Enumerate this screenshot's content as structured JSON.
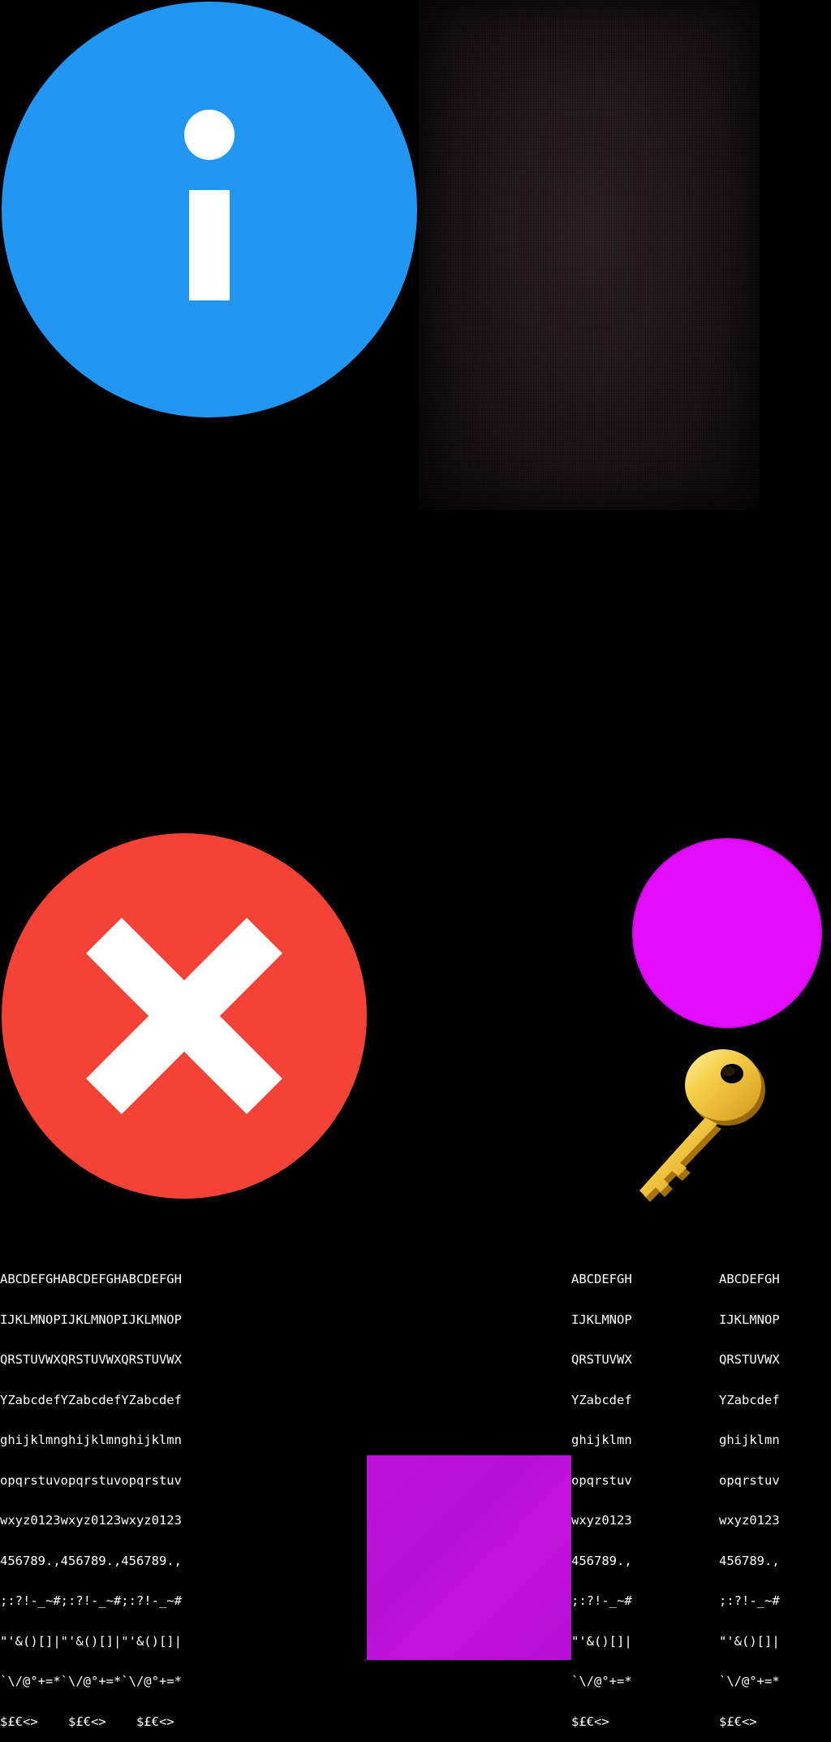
{
  "sprites": {
    "info_icon": {
      "icon": "info-icon",
      "circle_color": "#2196f3",
      "glyph_color": "#ffffff"
    },
    "fabric_texture": {
      "icon": "fabric-texture",
      "base_color": "#1d1517"
    },
    "close_icon": {
      "icon": "close-icon",
      "circle_color": "#f44336",
      "glyph_color": "#ffffff"
    },
    "magenta_circle": {
      "icon": "circle-shape",
      "color": "#e60cff"
    },
    "key_icon": {
      "icon": "key-icon",
      "color": "#f2c33a"
    },
    "purple_square": {
      "icon": "square-shape",
      "color": "#bd12dc"
    }
  },
  "font_sheets": {
    "large": [
      "ABCDEFGHABCDEFGHABCDEFGH",
      "IJKLMNOPIJKLMNOPIJKLMNOP",
      "QRSTUVWXQRSTUVWXQRSTUVWX",
      "YZabcdefYZabcdefYZabcdef",
      "ghijklmnghijklmnghijklmn",
      "opqrstuvopqrstuvopqrstuv",
      "wxyz0123wxyz0123wxyz0123",
      "456789.,456789.,456789.,",
      ";:?!-_~#;:?!-_~#;:?!-_~#",
      "\"'&()[]|\"'&()[]|\"'&()[]|",
      "`\\/@°+=*`\\/@°+=*`\\/@°+=*",
      "$£€<>    $£€<>    $£€<> "
    ],
    "small": [
      "ABCDEFGH",
      "IJKLMNOP",
      "QRSTUVWX",
      "YZabcdef",
      "ghijklmn",
      "opqrstuv",
      "wxyz0123",
      "456789.,",
      ";:?!-_~#",
      "\"'&()[]|",
      "`\\/@°+=*",
      "$£€<>   "
    ]
  }
}
